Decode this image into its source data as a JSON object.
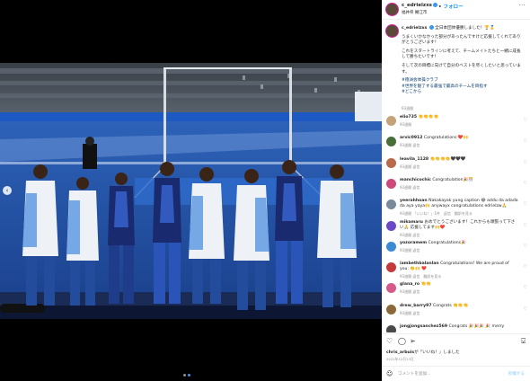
{
  "header": {
    "username": "c_edrielzxs",
    "follow_label": "フォロー",
    "follow_dot": "•",
    "location": "福井県 鯖江市",
    "more_icon": "more-icon"
  },
  "caption": {
    "username": "c_edrielzxs",
    "line1": "全日本団体優勝しました！🏆🥇",
    "line2": "うまくいかなかった部分があったんですけど応援してくれてありがとうございます！",
    "line3": "これをスタートラインに考えて、チームメイトたちと一緒に成長して勝ちたいです！",
    "line4": "そして次の目標に向けて自分のベストを尽くしたいと思っています。",
    "hashtags": [
      "#徳洲会体操クラブ",
      "#世界を魅了する最強で最高のチームを目指す",
      "#どこから"
    ],
    "time": "93週間"
  },
  "comments": [
    {
      "username": "elio735",
      "text": "👏👏👏👏",
      "time": "93週間",
      "reply": "",
      "avatar": "#c4a27a"
    },
    {
      "username": "arvic0912",
      "text": "Congratulations ❤️🙌",
      "time": "93週間",
      "reply": "返信",
      "avatar": "#4a6e3a"
    },
    {
      "username": "leavila_1128",
      "text": "👏👏👏👏🖤🖤🖤",
      "time": "93週間",
      "reply": "返信",
      "avatar": "#b86a4a"
    },
    {
      "username": "manchicochic",
      "text": "Congratulation🎉🎊",
      "time": "93週間",
      "reply": "返信",
      "avatar": "#cc4a7a"
    },
    {
      "username": "yeerahhoan",
      "text": "Nakakayak yung caption 😂 addu da adada da aya yaya🙌 anywayx congratulations edrielzw🙏",
      "time": "93週間",
      "reply": "「いいね！」1件　返信　翻訳を見る",
      "avatar": "#7a8a9a"
    },
    {
      "username": "mikamaru",
      "text": "おめでとうございます！これからも頑張って下さい🙏 応援してます🙌❤️",
      "time": "93週間",
      "reply": "返信",
      "avatar": "#6a4ac4"
    },
    {
      "username": "yozoramem",
      "text": "Congratulations🎉",
      "time": "93週間",
      "reply": "返信",
      "avatar": "#3a8ad4"
    },
    {
      "username": "iambethbalanlan",
      "text": "Congratulations! We are proud of you. 👏🙌 ❤️",
      "time": "93週間",
      "reply": "返信　翻訳を見る",
      "avatar": "#c43a3a"
    },
    {
      "username": "glana_ro",
      "text": "👏👏",
      "time": "93週間",
      "reply": "返信",
      "avatar": "#d45a8a"
    },
    {
      "username": "drew_barry97",
      "text": "Congrats 👏👏👏",
      "time": "93週間",
      "reply": "返信",
      "avatar": "#8a6a3a"
    },
    {
      "username": "jongjongsanchez569",
      "text": "Congrats 🎉🎉🎉 🎉 merry",
      "time": "",
      "reply": "",
      "avatar": "#4a4a4a"
    }
  ],
  "likes": {
    "user": "chris_arbuis",
    "rest": "その他",
    "suffix": "が「いいね！」しました"
  },
  "post_date": "2021年12月13日",
  "comment_box": {
    "placeholder": "コメントを追加...",
    "post_label": "投稿する"
  },
  "colors": {
    "accent": "#0095f6",
    "verified": "#3897f0",
    "floor_blue": "#1f4ea3",
    "jersey_white": "#f2f4f7",
    "tank_navy": "#1a2a6e"
  }
}
